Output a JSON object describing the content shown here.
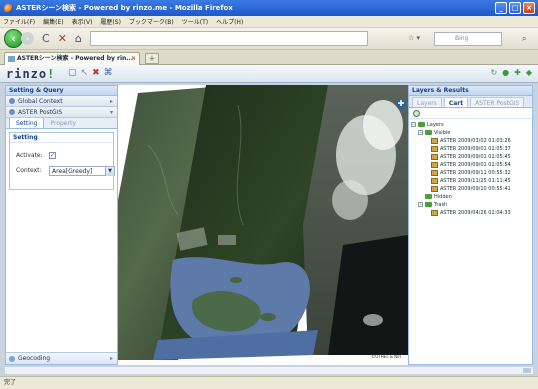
{
  "window": {
    "title": "ASTERシーン検索 - Powered by rinzo.me - Mozilla Firefox",
    "buttons": [
      "_",
      "□",
      "×"
    ]
  },
  "menu": [
    "ファイル(F)",
    "編集(E)",
    "表示(V)",
    "履歴(S)",
    "ブックマーク(B)",
    "ツール(T)",
    "ヘルプ(H)"
  ],
  "nav": {
    "back_label": "‹",
    "search_placeholder": "Bing"
  },
  "browser_tab": {
    "label": "ASTERシーン検索 - Powered by rin...",
    "new_tab": "+"
  },
  "app": {
    "logo_left": "rinzo",
    "logo_sep": "!"
  },
  "left_panel": {
    "header": "Setting & Query",
    "accordions": [
      "Global Context",
      "ASTER PostGIS"
    ],
    "subtabs": [
      "Setting",
      "Property"
    ],
    "fieldset_legend": "Setting",
    "activate_label": "Activate:",
    "activate_checked": true,
    "context_label": "Context:",
    "context_value": "Area[Greedy]",
    "bottom_accordion": "Geocoding"
  },
  "map": {
    "credit": "©OTHEL & NIIT"
  },
  "right_panel": {
    "header": "Layers & Results",
    "tabs": [
      "Layers",
      "Cart",
      "ASTER PostGIS"
    ],
    "active_tab": "Cart",
    "tree": {
      "root": "Layers",
      "visible": "Visible",
      "visible_items": [
        "ASTER 2009/03/02 01:03:26",
        "ASTER 2009/09/01 02:05:37",
        "ASTER 2009/09/01 02:05:45",
        "ASTER 2009/09/01 02:05:54",
        "ASTER 2009/09/11 00:55:32",
        "ASTER 2009/11/25 01:11:45",
        "ASTER 2009/09/10 00:55:41"
      ],
      "hidden": "Hidden",
      "trash": "Trash",
      "trash_items": [
        "ASTER 2009/04/26 02:04:33"
      ]
    }
  },
  "status": {
    "text": "完了"
  }
}
